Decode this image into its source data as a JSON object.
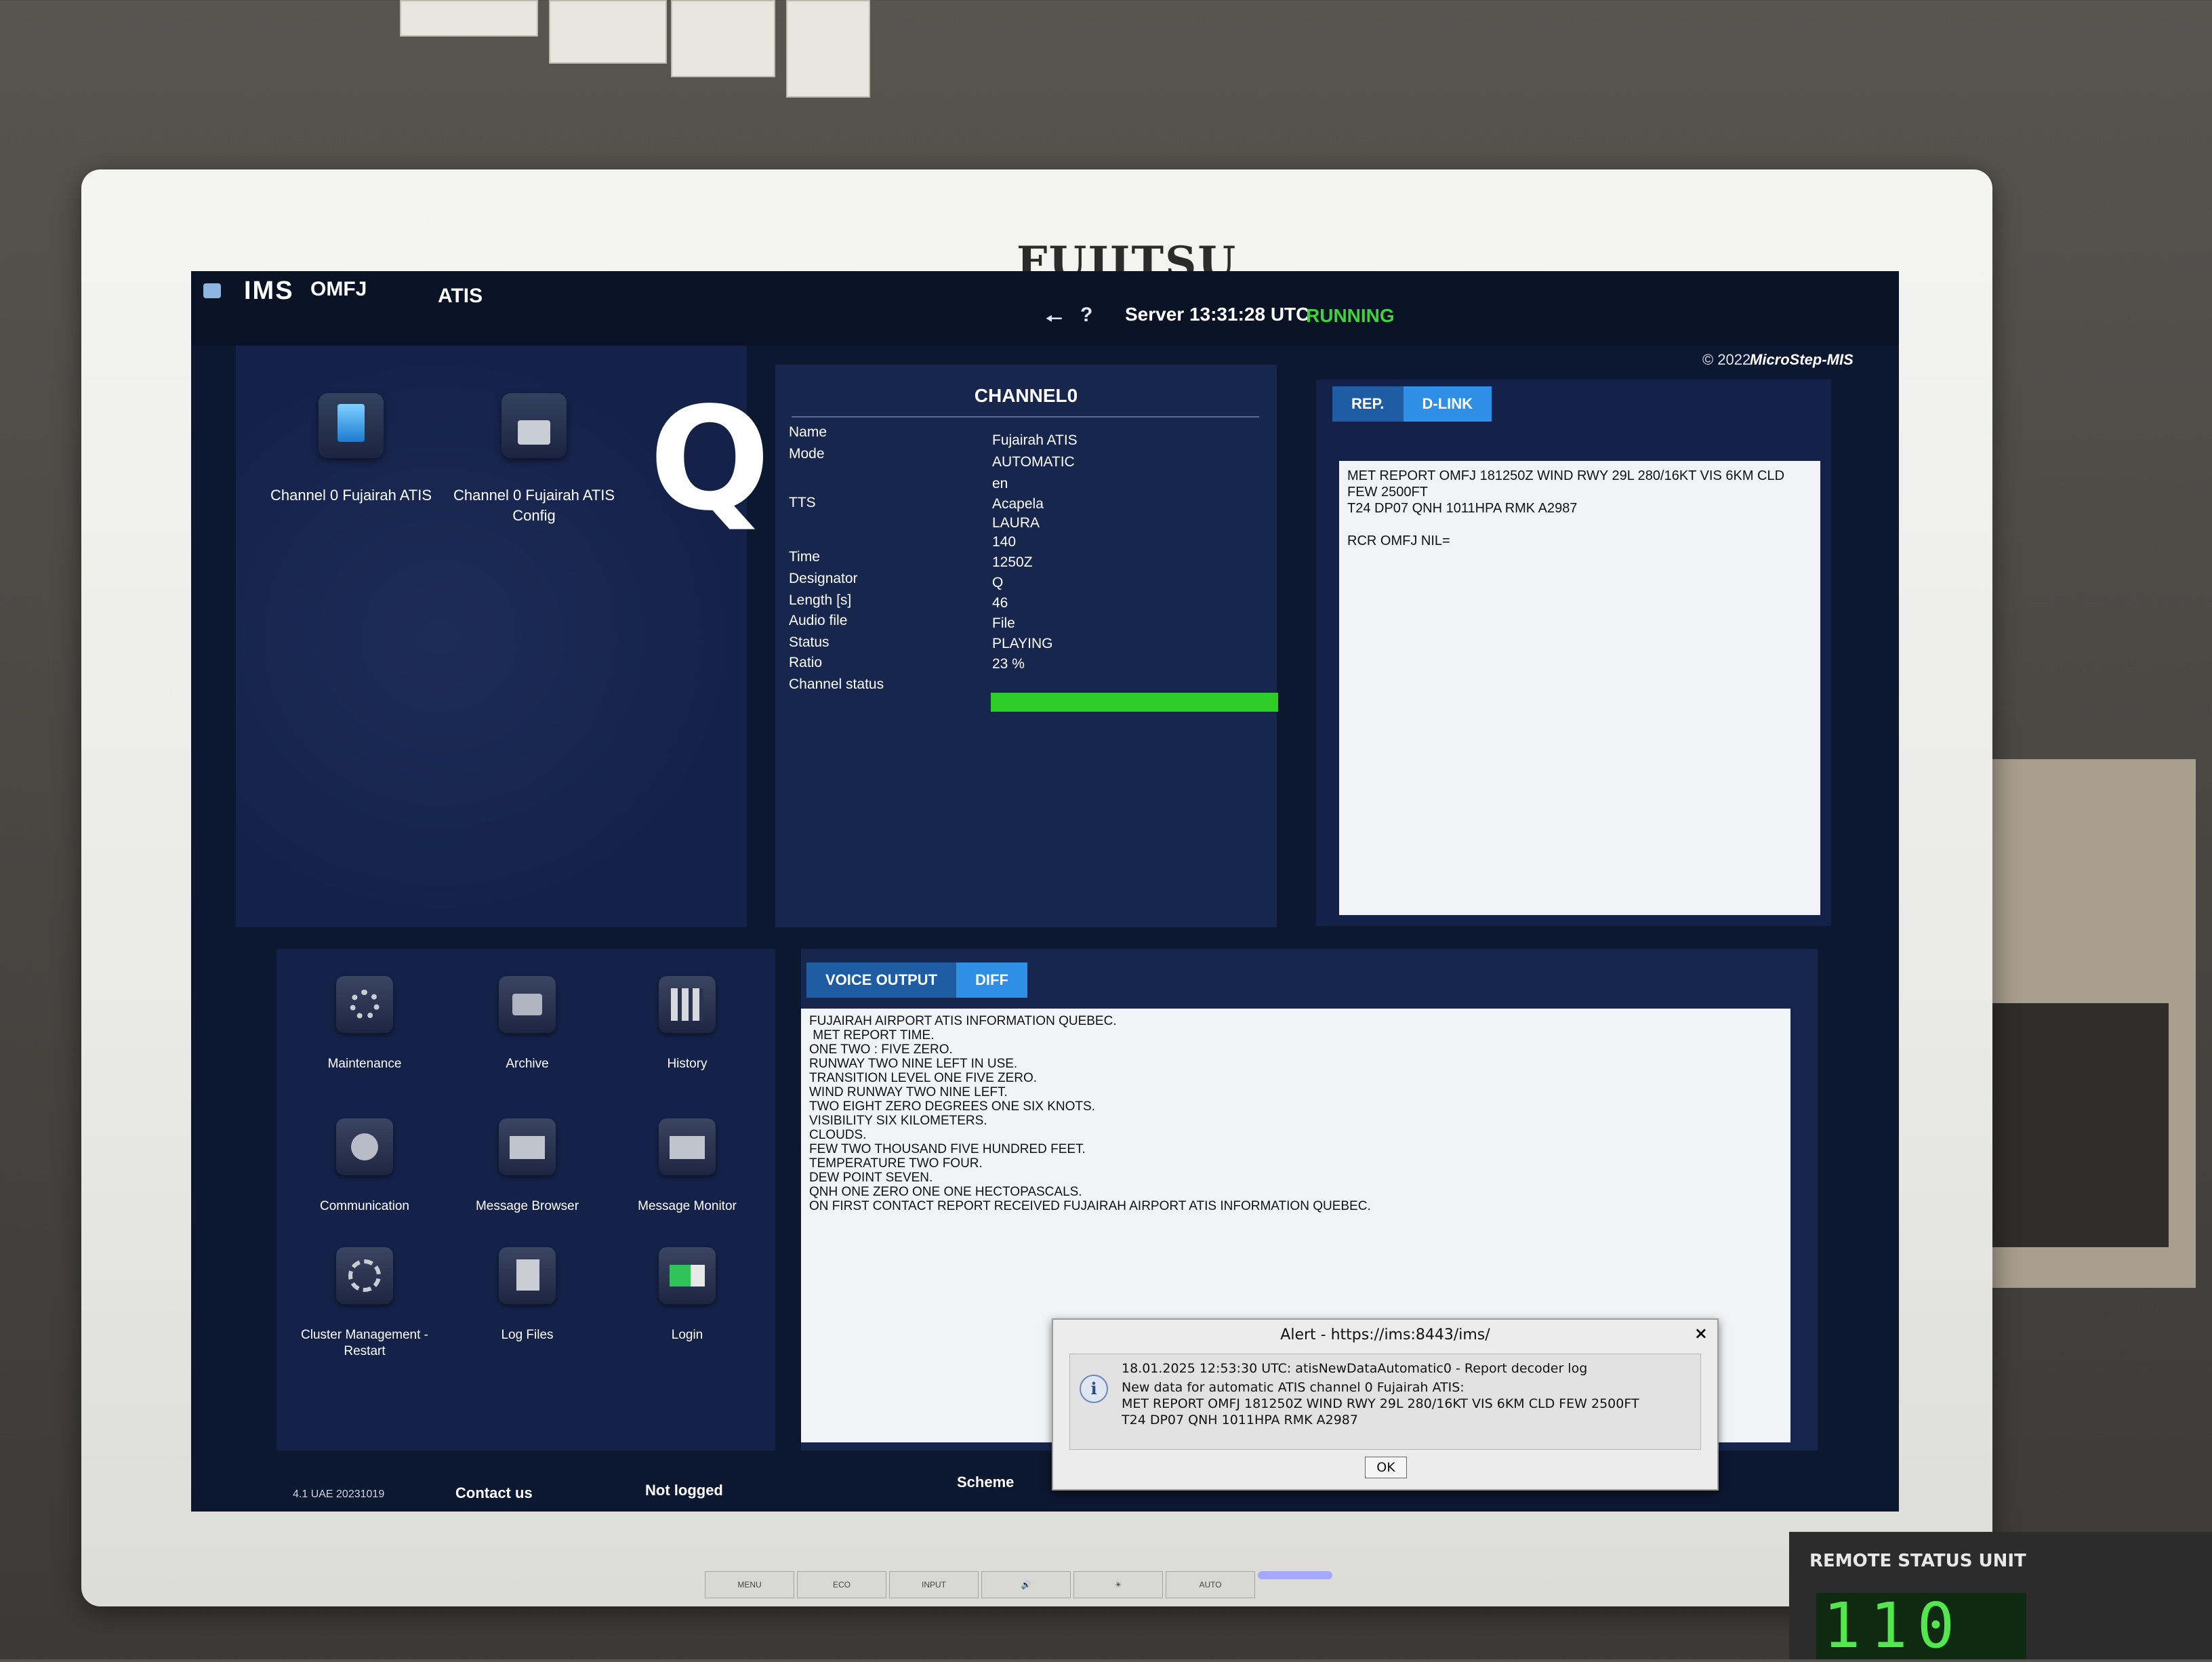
{
  "monitor": {
    "brand": "FUJITSU"
  },
  "topbar": {
    "app_name": "IMS",
    "station": "OMFJ",
    "module": "ATIS",
    "server_time": "Server 13:31:28 UTC",
    "server_status": "RUNNING",
    "copyright": "© 2022",
    "vendor": "MicroStep-MIS"
  },
  "apps": [
    {
      "label": "Channel 0 Fujairah ATIS",
      "icon": "atis-icon"
    },
    {
      "label": "Channel 0 Fujairah ATIS Config",
      "icon": "config-icon"
    }
  ],
  "designator_badge": "Q",
  "channel": {
    "title": "CHANNEL0",
    "fields": [
      {
        "label": "Name",
        "value": "Fujairah ATIS"
      },
      {
        "label": "Mode",
        "value": "AUTOMATIC"
      },
      {
        "label": "",
        "value": "en"
      },
      {
        "label": "TTS",
        "value": "Acapela"
      },
      {
        "label": "",
        "value": "LAURA"
      },
      {
        "label": "",
        "value": "140"
      },
      {
        "label": "Time",
        "value": "1250Z"
      },
      {
        "label": "Designator",
        "value": "Q"
      },
      {
        "label": "Length [s]",
        "value": "46"
      },
      {
        "label": "Audio file",
        "value": "File"
      },
      {
        "label": "Status",
        "value": "PLAYING"
      },
      {
        "label": "Ratio",
        "value": "23 %"
      },
      {
        "label": "Channel status",
        "value": ""
      }
    ],
    "channel_status_fraction": 1.0,
    "status_color": "#2ecc26"
  },
  "report": {
    "tabs": [
      "REP.",
      "D-LINK"
    ],
    "active_tab": "REP.",
    "text": "MET REPORT OMFJ 181250Z WIND RWY 29L 280/16KT VIS 6KM CLD FEW 2500FT\nT24 DP07 QNH 1011HPA RMK A2987\n\nRCR OMFJ NIL="
  },
  "tools": [
    {
      "label": "Maintenance",
      "icon": "gear-icon"
    },
    {
      "label": "Archive",
      "icon": "folder-icon"
    },
    {
      "label": "History",
      "icon": "history-icon"
    },
    {
      "label": "Communication",
      "icon": "communication-icon"
    },
    {
      "label": "Message Browser",
      "icon": "mail-icon"
    },
    {
      "label": "Message Monitor",
      "icon": "mail-icon"
    },
    {
      "label": "Cluster Management - Restart",
      "icon": "cluster-icon"
    },
    {
      "label": "Log Files",
      "icon": "file-icon"
    },
    {
      "label": "Login",
      "icon": "login-icon"
    }
  ],
  "voice": {
    "tabs": [
      "VOICE OUTPUT",
      "DIFF"
    ],
    "active_tab": "VOICE OUTPUT",
    "text": "FUJAIRAH AIRPORT ATIS INFORMATION QUEBEC.\n MET REPORT TIME.\nONE TWO : FIVE ZERO.\nRUNWAY TWO NINE LEFT IN USE.\nTRANSITION LEVEL ONE FIVE ZERO.\nWIND RUNWAY TWO NINE LEFT.\nTWO EIGHT ZERO DEGREES ONE SIX KNOTS.\nVISIBILITY SIX KILOMETERS.\nCLOUDS.\nFEW TWO THOUSAND FIVE HUNDRED FEET.\nTEMPERATURE TWO FOUR.\nDEW POINT SEVEN.\nQNH ONE ZERO ONE ONE HECTOPASCALS.\nON FIRST CONTACT REPORT RECEIVED FUJAIRAH AIRPORT ATIS INFORMATION QUEBEC."
  },
  "footer": {
    "version": "4.1 UAE 20231019",
    "contact": "Contact us",
    "login_state": "Not logged",
    "scheme": "Scheme"
  },
  "alert": {
    "title": "Alert - https://ims:8443/ims/",
    "close": "×",
    "line1": "18.01.2025 12:53:30 UTC:  atisNewDataAutomatic0 - Report decoder log",
    "line2": "New data for automatic ATIS channel 0 Fujairah ATIS:",
    "line3": "MET REPORT OMFJ 181250Z WIND RWY 29L 280/16KT VIS 6KM CLD FEW 2500FT",
    "line4": "T24 DP07 QNH 1011HPA RMK A2987",
    "ok": "OK"
  },
  "monitor_buttons": [
    "MENU",
    "ECO",
    "INPUT",
    "",
    "",
    "AUTO"
  ],
  "remote_unit": {
    "label": "REMOTE STATUS UNIT",
    "display": "110"
  }
}
